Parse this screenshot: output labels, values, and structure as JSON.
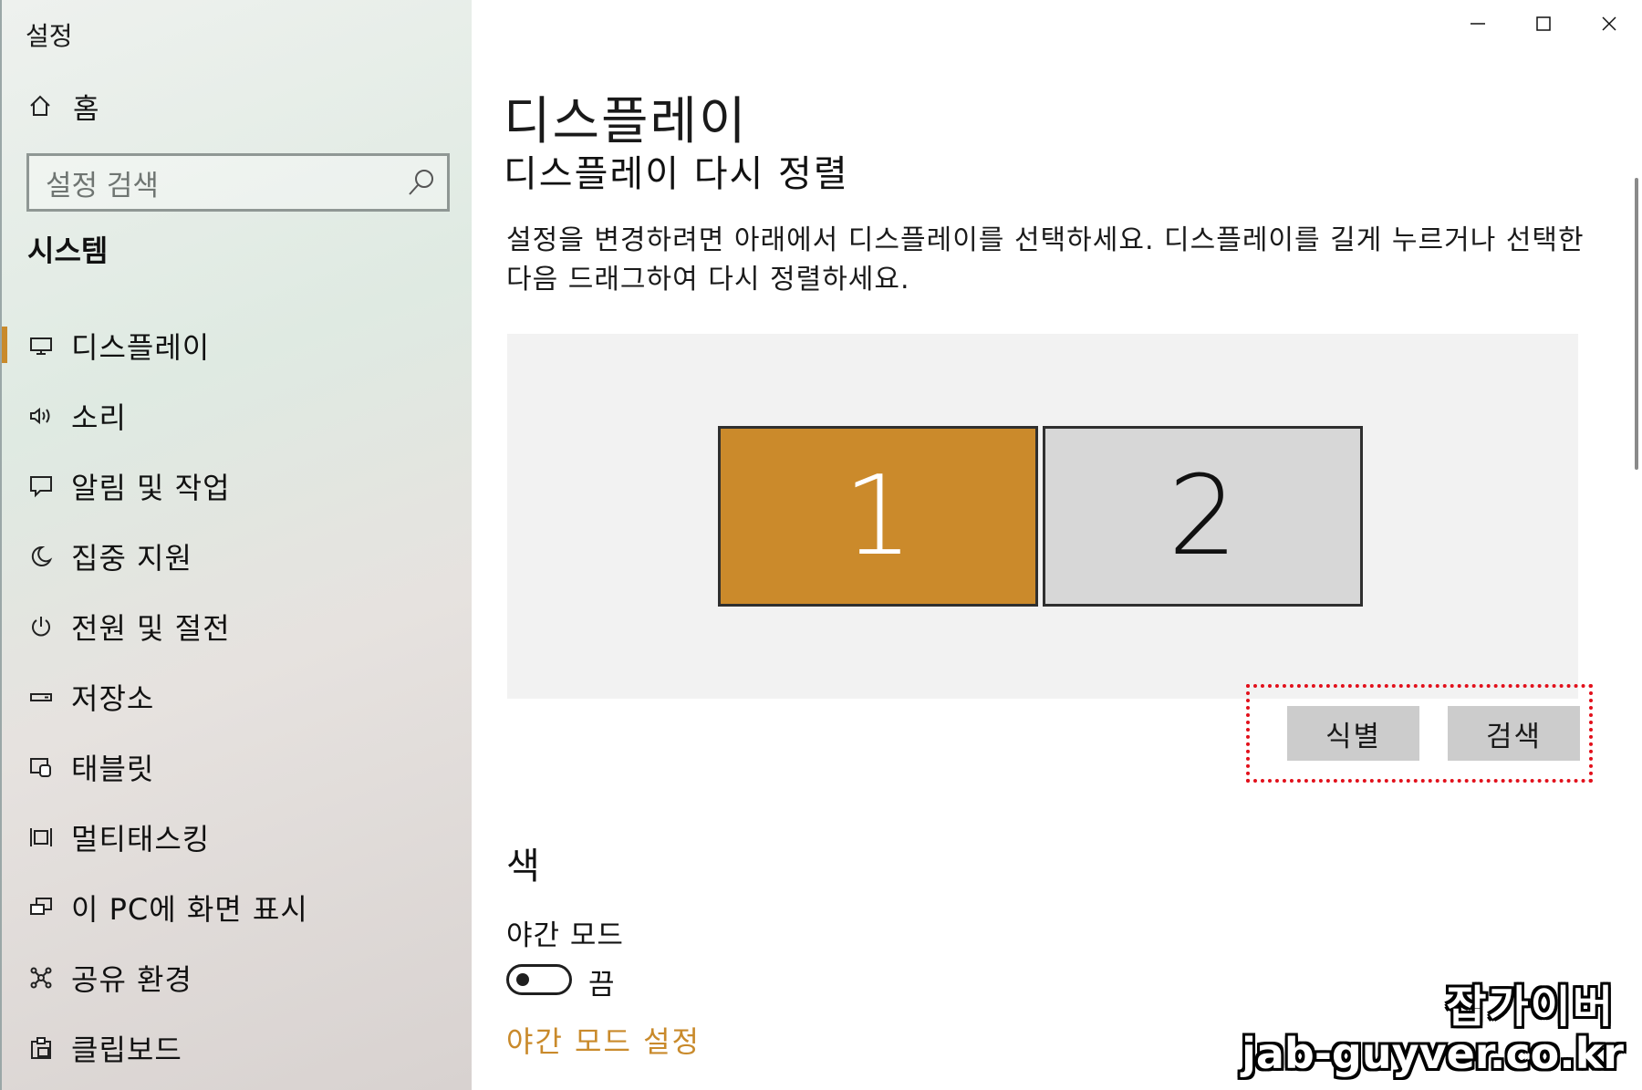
{
  "window": {
    "title": "설정",
    "controls": [
      "minimize-icon",
      "maximize-icon",
      "close-icon"
    ]
  },
  "sidebar": {
    "home_label": "홈",
    "search_placeholder": "설정 검색",
    "section_title": "시스템",
    "items": [
      {
        "label": "디스플레이",
        "icon": "monitor-icon",
        "active": true
      },
      {
        "label": "소리",
        "icon": "speaker-icon",
        "active": false
      },
      {
        "label": "알림 및 작업",
        "icon": "notification-icon",
        "active": false
      },
      {
        "label": "집중 지원",
        "icon": "moon-icon",
        "active": false
      },
      {
        "label": "전원 및 절전",
        "icon": "power-icon",
        "active": false
      },
      {
        "label": "저장소",
        "icon": "storage-icon",
        "active": false
      },
      {
        "label": "태블릿",
        "icon": "tablet-icon",
        "active": false
      },
      {
        "label": "멀티태스킹",
        "icon": "multitasking-icon",
        "active": false
      },
      {
        "label": "이 PC에 화면 표시",
        "icon": "project-icon",
        "active": false
      },
      {
        "label": "공유 환경",
        "icon": "share-icon",
        "active": false
      },
      {
        "label": "클립보드",
        "icon": "clipboard-icon",
        "active": false
      }
    ]
  },
  "main": {
    "title": "디스플레이",
    "subtitle": "디스플레이 다시 정렬",
    "description": "설정을 변경하려면 아래에서 디스플레이를 선택하세요. 디스플레이를 길게 누르거나 선택한 다음 드래그하여 다시 정렬하세요.",
    "monitors": [
      {
        "number": "1",
        "selected": true,
        "color": "#cb8a2b"
      },
      {
        "number": "2",
        "selected": false,
        "color": "#d7d7d7"
      }
    ],
    "identify_label": "식별",
    "detect_label": "검색",
    "color_section": "색",
    "night_mode_label": "야간 모드",
    "night_mode_state": "끔",
    "night_mode_link": "야간 모드 설정"
  },
  "watermark": {
    "korean": "잡가이버",
    "url": "jab-guyver.co.kr"
  },
  "colors": {
    "accent": "#c98a2b",
    "highlight_box": "#e2101b"
  }
}
